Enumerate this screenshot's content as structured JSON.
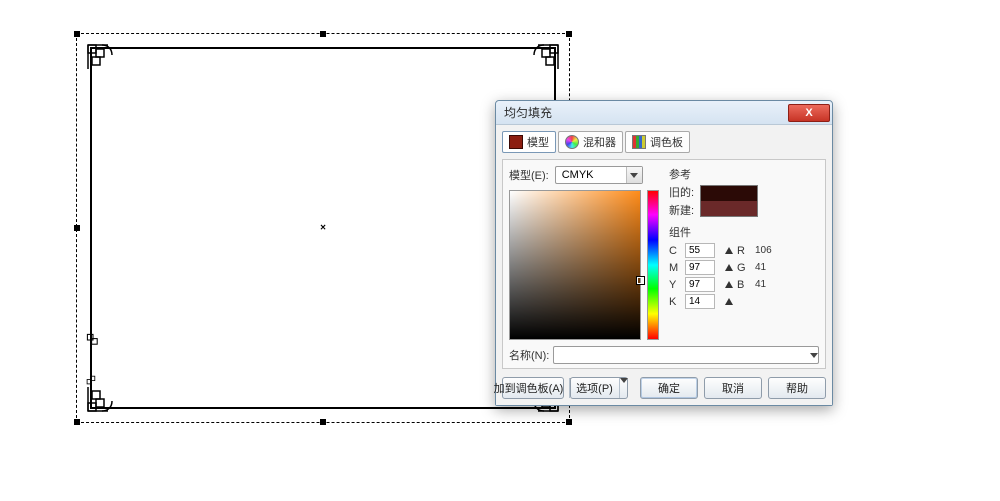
{
  "dialog": {
    "title": "均匀填充",
    "close_glyph": "X",
    "tabs": {
      "model": "模型",
      "mixer": "混和器",
      "palette": "调色板"
    },
    "model_label": "模型(E):",
    "model_value": "CMYK",
    "reference_label": "参考",
    "old_label": "旧的:",
    "new_label": "新建:",
    "components_label": "组件",
    "cmyk": {
      "Clabel": "C",
      "C": 55,
      "Mlabel": "M",
      "M": 97,
      "Ylabel": "Y",
      "Y": 97,
      "Klabel": "K",
      "K": 14
    },
    "rgb": {
      "Rlabel": "R",
      "R": 106,
      "Glabel": "G",
      "G": 41,
      "Blabel": "B",
      "B": 41
    },
    "name_label": "名称(N):",
    "name_value": "",
    "buttons": {
      "add_palette": "加到调色板(A)",
      "options": "选项(P)",
      "ok": "确定",
      "cancel": "取消",
      "help": "帮助"
    },
    "colors": {
      "old": "#2b0a06",
      "new": "#6a2929"
    }
  }
}
